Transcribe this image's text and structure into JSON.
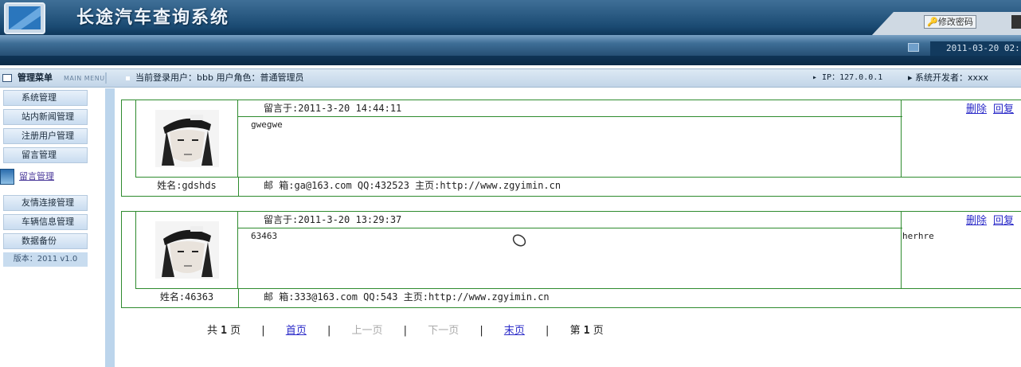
{
  "header": {
    "title": "长途汽车查询系统",
    "change_password": "修改密码",
    "datetime": "2011-03-20 02:"
  },
  "infobar": {
    "menu_label": "管理菜单",
    "menu_sub": "MAIN MENU",
    "user_text": "当前登录用户：bbb  用户角色：普通管理员",
    "ip_text": "▸ IP：127.0.0.1",
    "dev_text": "▸  系统开发者：xxxx"
  },
  "sidebar": {
    "items": [
      {
        "label": "系统管理"
      },
      {
        "label": "站内新闻管理"
      },
      {
        "label": "注册用户管理"
      },
      {
        "label": "留言管理"
      }
    ],
    "active_sub": "留言管理",
    "items_after": [
      {
        "label": "友情连接管理"
      },
      {
        "label": "车辆信息管理"
      },
      {
        "label": "数据备份"
      }
    ],
    "version": "版本：2011 v1.0"
  },
  "messages": [
    {
      "time": "留言于:2011-3-20 14:44:11",
      "delete": "删除",
      "reply_link": "回复",
      "body": "gwegwe",
      "reply": "",
      "name": "姓名:gdshds",
      "contact": "邮 箱:ga@163.com    QQ:432523    主页:http://www.zgyimin.cn"
    },
    {
      "time": "留言于:2011-3-20 13:29:37",
      "delete": "删除",
      "reply_link": "回复",
      "body": "63463",
      "reply": "herhre",
      "name": "姓名:46363",
      "contact": "邮 箱:333@163.com    QQ:543    主页:http://www.zgyimin.cn"
    }
  ],
  "pager": {
    "total_pre": "共",
    "total_num": "1",
    "total_post": "页",
    "sep": "|",
    "first": "首页",
    "prev": "上一页",
    "next": "下一页",
    "last": "末页",
    "cur_pre": "第",
    "cur_num": "1",
    "cur_post": "页"
  }
}
